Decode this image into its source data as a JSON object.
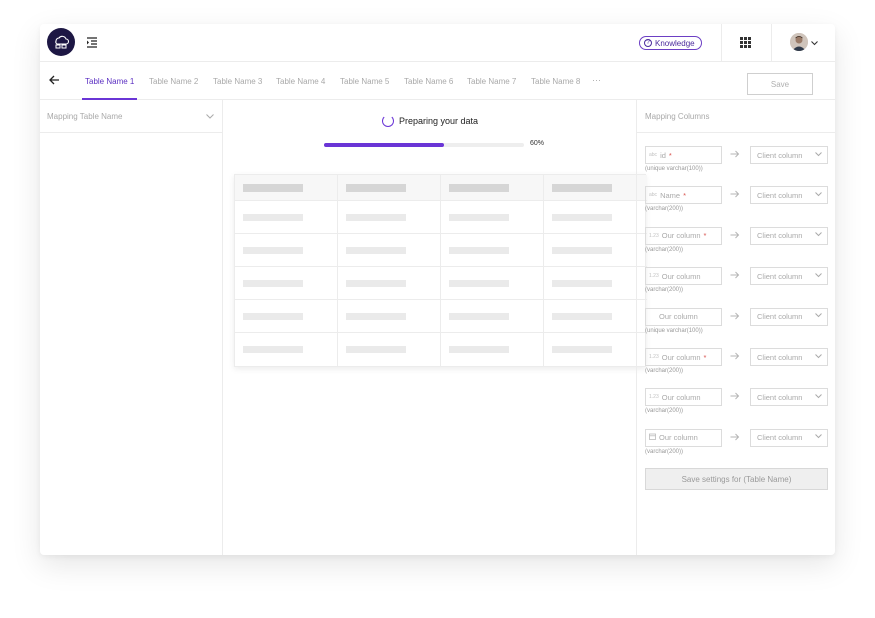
{
  "header": {
    "knowledge_label": "Knowledge",
    "knowledge_icon": "question-circle-icon",
    "apps_icon": "apps-grid-icon",
    "avatar_icon": "user-avatar",
    "menu_icon": "indent-menu-icon"
  },
  "tabs": [
    {
      "label": "Table Name 1",
      "active": true
    },
    {
      "label": "Table Name 2"
    },
    {
      "label": "Table Name 3"
    },
    {
      "label": "Table Name 4"
    },
    {
      "label": "Table Name 5"
    },
    {
      "label": "Table Name 6"
    },
    {
      "label": "Table Name 7"
    },
    {
      "label": "Table Name 8"
    }
  ],
  "tabs_more": "···",
  "save_label": "Save",
  "left_panel": {
    "title": "Mapping Table Name"
  },
  "loading": {
    "text": "Preparing your data",
    "progress_pct": 60,
    "progress_label": "60%"
  },
  "right_panel": {
    "title": "Mapping Columns",
    "rows": [
      {
        "type_icon": "abc",
        "name": "id",
        "required": true,
        "sub": "(unique varchar(100))",
        "client": "Client column"
      },
      {
        "type_icon": "abc",
        "name": "Name",
        "required": true,
        "sub": "(varchar(200))",
        "client": "Client column"
      },
      {
        "type_icon": "1.23",
        "name": "Our column",
        "required": true,
        "sub": "(varchar(200))",
        "client": "Client column"
      },
      {
        "type_icon": "1.23",
        "name": "Our column",
        "required": false,
        "sub": "(varchar(200))",
        "client": "Client column"
      },
      {
        "type_icon": "",
        "name": "Our column",
        "required": false,
        "sub": "(unique varchar(100))",
        "client": "Client column"
      },
      {
        "type_icon": "1.23",
        "name": "Our column",
        "required": true,
        "sub": "(varchar(200))",
        "client": "Client column"
      },
      {
        "type_icon": "1.23",
        "name": "Our column",
        "required": false,
        "sub": "(varchar(200))",
        "client": "Client column"
      },
      {
        "type_icon": "calendar",
        "name": "Our column",
        "required": false,
        "sub": "(varchar(200))",
        "client": "Client column"
      }
    ],
    "save_settings_label": "Save settings for (Table Name)"
  },
  "colors": {
    "accent": "#6a35d6",
    "logo_bg": "#1d1744"
  }
}
